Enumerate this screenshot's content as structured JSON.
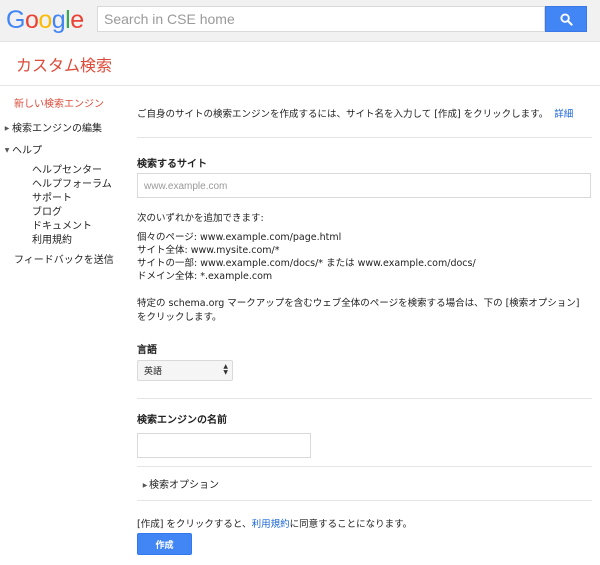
{
  "header": {
    "logo_letters": [
      "G",
      "o",
      "o",
      "g",
      "l",
      "e"
    ],
    "logo_colors": [
      "#4285f4",
      "#ea4335",
      "#fbbc05",
      "#4285f4",
      "#34a853",
      "#ea4335"
    ],
    "search_placeholder": "Search in CSE home",
    "search_button_icon": "search-icon",
    "accent_color": "#4285f4"
  },
  "product_title": "カスタム検索",
  "sidebar": {
    "items": [
      {
        "label": "新しい検索エンジン",
        "active": true
      },
      {
        "label": "検索エンジンの編集",
        "expander": "collapsed"
      },
      {
        "label": "ヘルプ",
        "expander": "expanded"
      },
      {
        "label": "ヘルプセンター"
      },
      {
        "label": "ヘルプフォーラム"
      },
      {
        "label": "サポート"
      },
      {
        "label": "ブログ"
      },
      {
        "label": "ドキュメント"
      },
      {
        "label": "利用規約"
      },
      {
        "label": "フィードバックを送信"
      }
    ]
  },
  "main": {
    "intro_text": "ご自身のサイトの検索エンジンを作成するには、サイト名を入力して [作成] をクリックします。",
    "intro_link": "詳細",
    "sites_label": "検索するサイト",
    "sites_placeholder": "www.example.com",
    "add_intro": "次のいずれかを追加できます:",
    "examples": [
      "個々のページ: www.example.com/page.html",
      "サイト全体: www.mysite.com/*",
      "サイトの一部: www.example.com/docs/* または www.example.com/docs/",
      "ドメイン全体: *.example.com"
    ],
    "schema_note_1": "特定の schema.org マークアップを含むウェブ全体のページを検索する場合は、下の [検索オプション]",
    "schema_note_2": "をクリックします。",
    "language_label": "言語",
    "language_value": "英語",
    "engine_name_label": "検索エンジンの名前",
    "engine_name_value": "",
    "options_label": "検索オプション",
    "terms_prefix": "[作成] をクリックすると、",
    "terms_link": "利用規約",
    "terms_suffix": "に同意することになります。",
    "create_button": "作成"
  }
}
